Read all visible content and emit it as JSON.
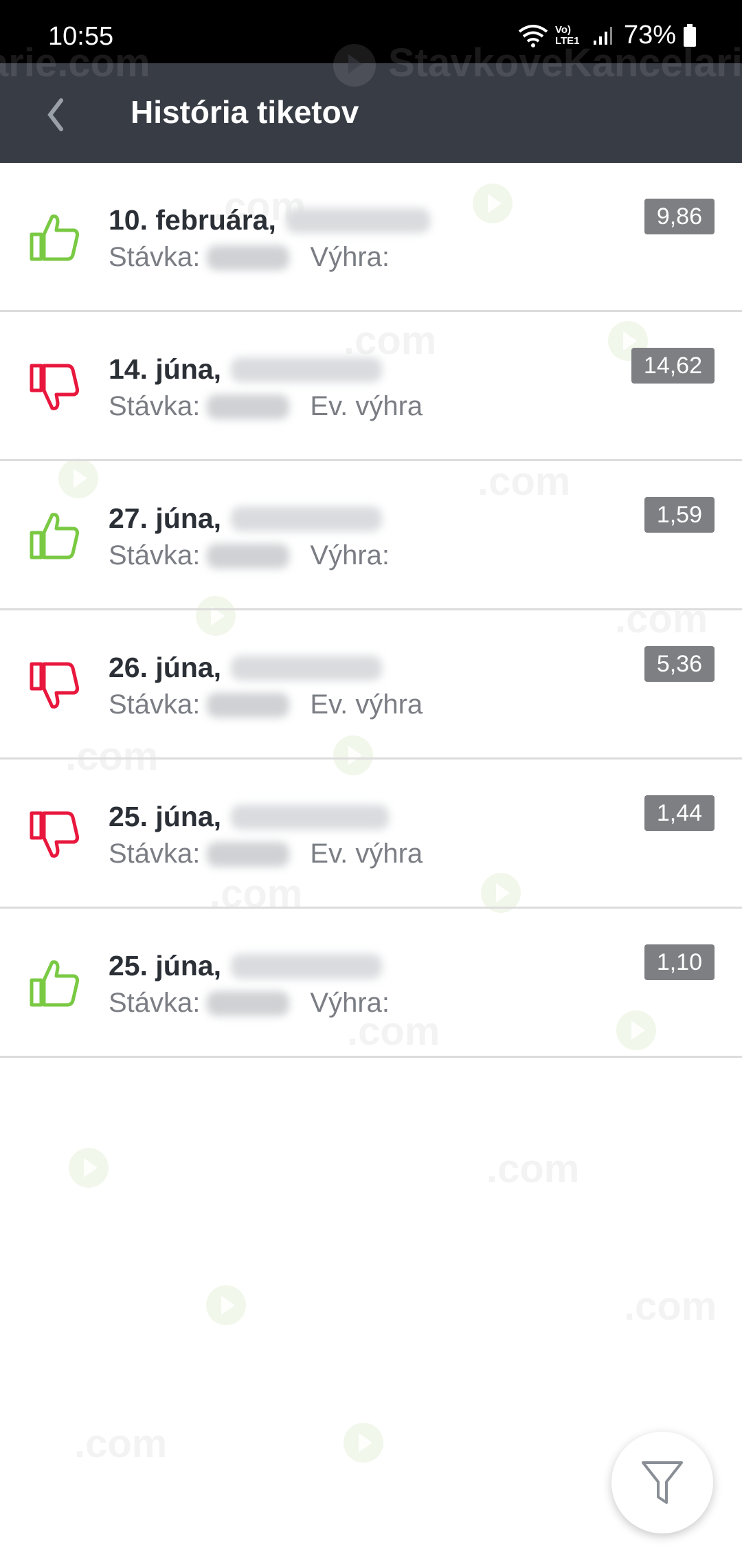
{
  "status_bar": {
    "time": "10:55",
    "network_label": "Vo) LTE1",
    "battery": "73%"
  },
  "header": {
    "title": "História tiketov",
    "background_color": "#383c44"
  },
  "watermark": {
    "brand": "StavkoveKancelarie",
    "fragment": "arie.com",
    "suffix": ".com"
  },
  "tickets": [
    {
      "date": "10. februára,",
      "stake_label": "Stávka:",
      "result_label": "Výhra:",
      "odds": "9,86",
      "status": "won",
      "icon": "thumbs-up-icon"
    },
    {
      "date": "14. júna,",
      "stake_label": "Stávka:",
      "result_label": "Ev. výhra",
      "odds": "14,62",
      "status": "lost",
      "icon": "thumbs-down-icon"
    },
    {
      "date": "27. júna,",
      "stake_label": "Stávka:",
      "result_label": "Výhra:",
      "odds": "1,59",
      "status": "won",
      "icon": "thumbs-up-icon"
    },
    {
      "date": "26. júna,",
      "stake_label": "Stávka:",
      "result_label": "Ev. výhra",
      "odds": "5,36",
      "status": "lost",
      "icon": "thumbs-down-icon"
    },
    {
      "date": "25. júna,",
      "stake_label": "Stávka:",
      "result_label": "Ev. výhra",
      "odds": "1,44",
      "status": "lost",
      "icon": "thumbs-down-icon"
    },
    {
      "date": "25. júna,",
      "stake_label": "Stávka:",
      "result_label": "Výhra:",
      "odds": "1,10",
      "status": "won",
      "icon": "thumbs-up-icon"
    }
  ],
  "colors": {
    "won": "#7ac943",
    "lost": "#e8173d",
    "odds_badge": "#7d7f83"
  },
  "fab": {
    "icon": "filter-icon"
  }
}
